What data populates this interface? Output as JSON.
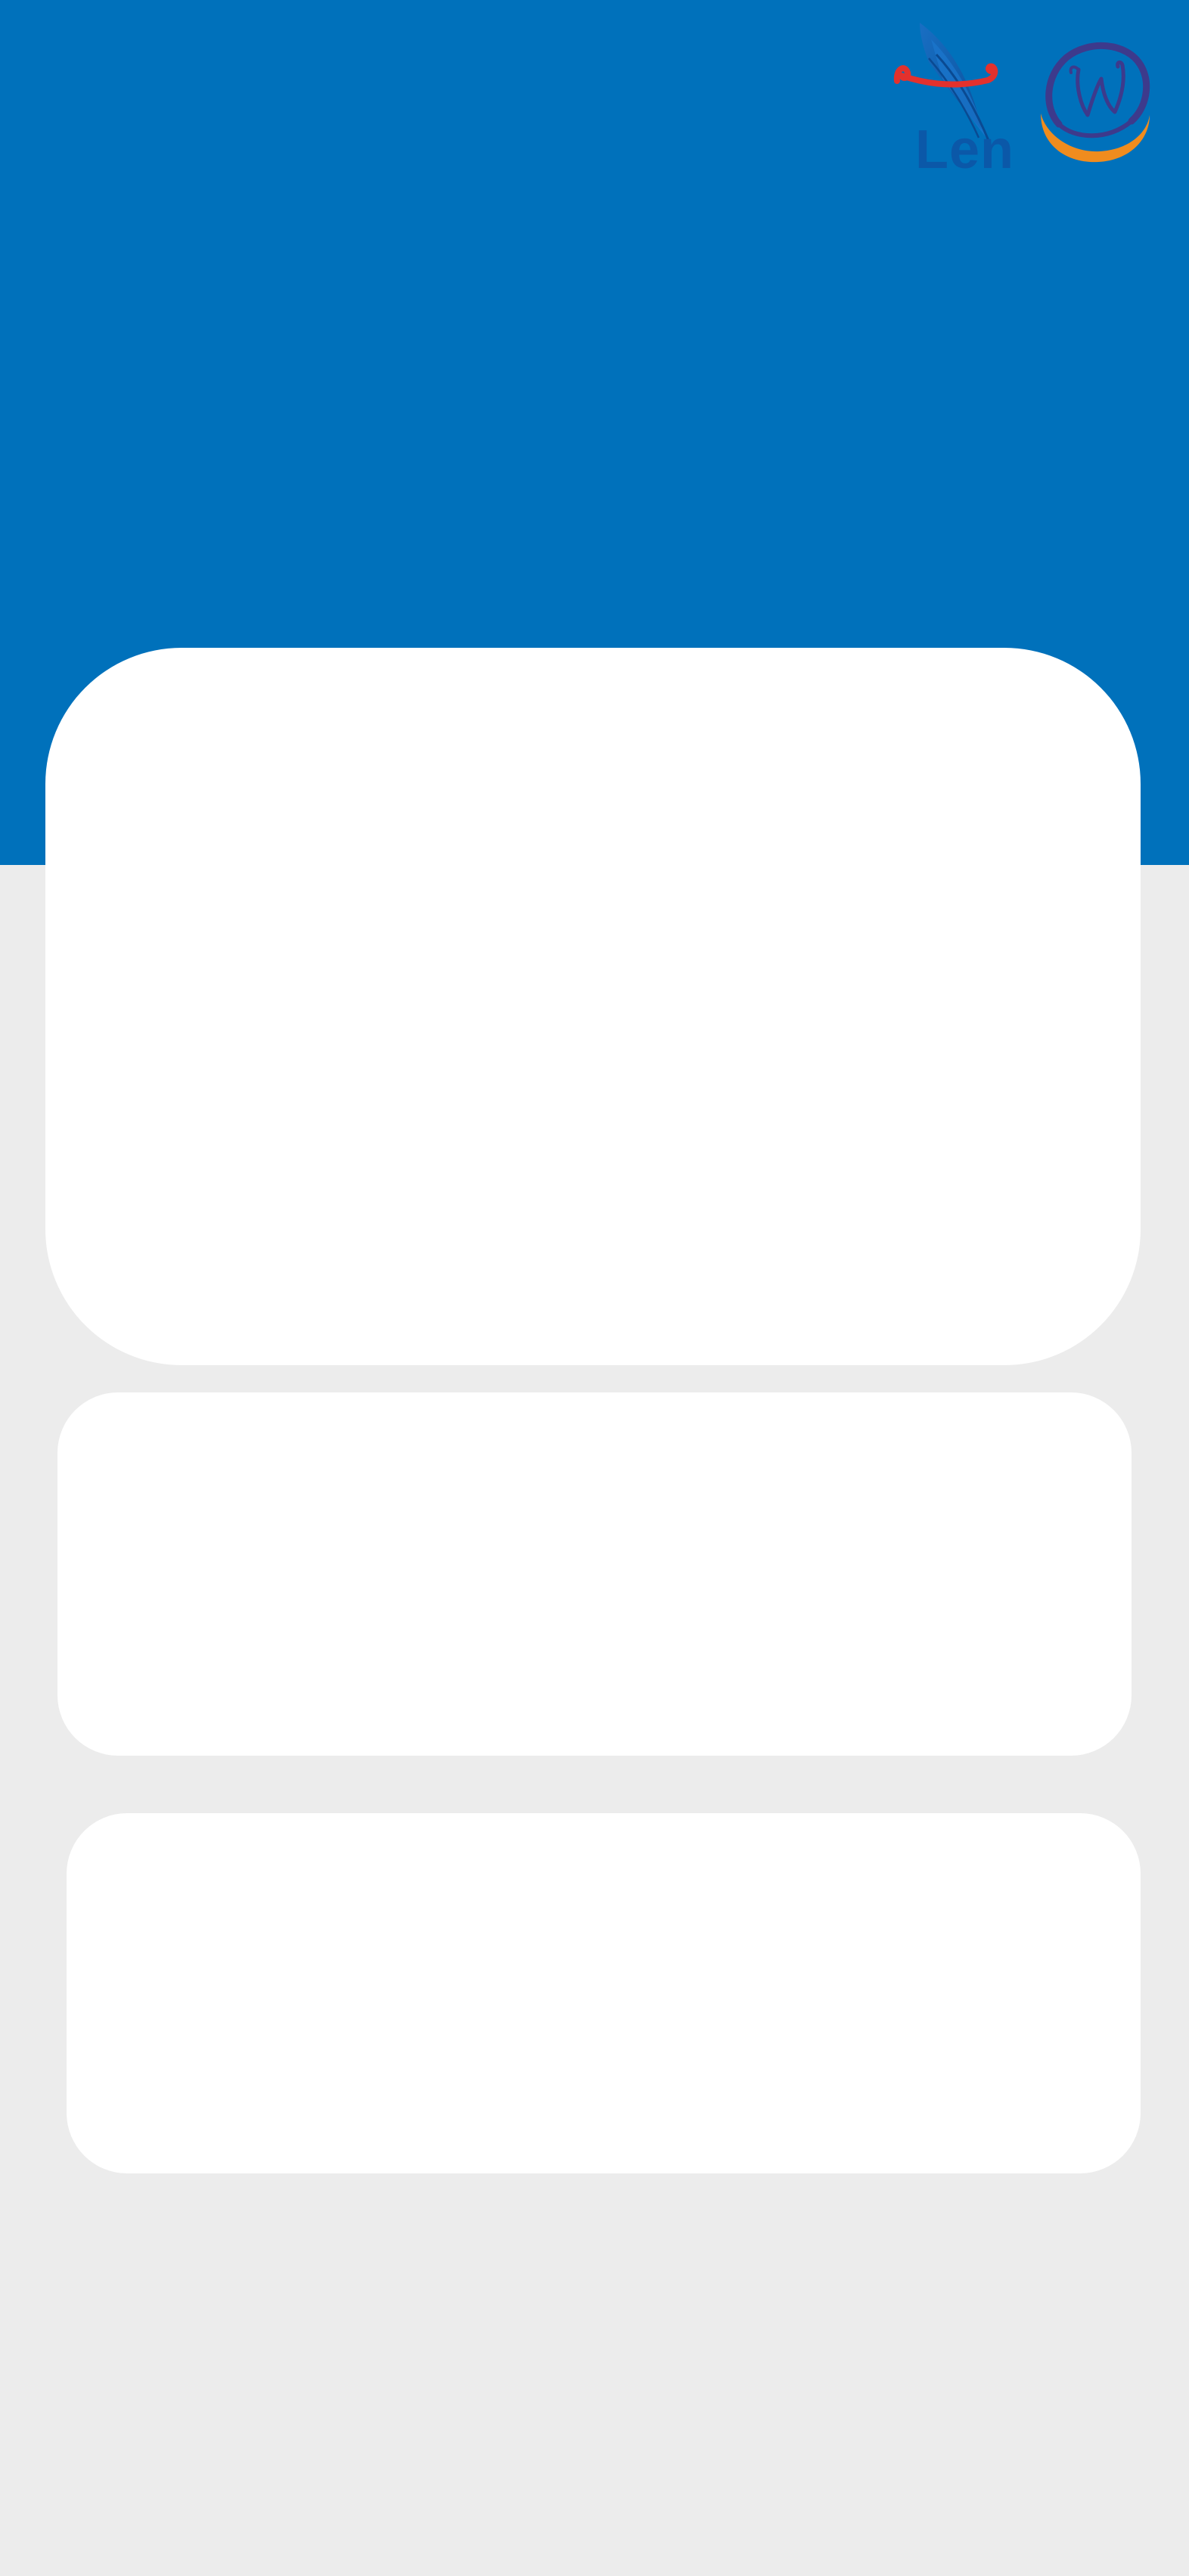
{
  "header": {
    "background_color": "#0071bb",
    "logos": [
      {
        "name": "len-logo",
        "text": "Len",
        "colors": [
          "#0b58a8",
          "#e3312d"
        ]
      },
      {
        "name": "w-monogram-logo",
        "colors": [
          "#3d3a8c",
          "#f08c1e"
        ]
      }
    ]
  },
  "page": {
    "background_color": "#ececec",
    "card_color": "#ffffff"
  },
  "cards": [
    {
      "name": "main-card"
    },
    {
      "name": "secondary-card"
    },
    {
      "name": "tertiary-card"
    }
  ]
}
